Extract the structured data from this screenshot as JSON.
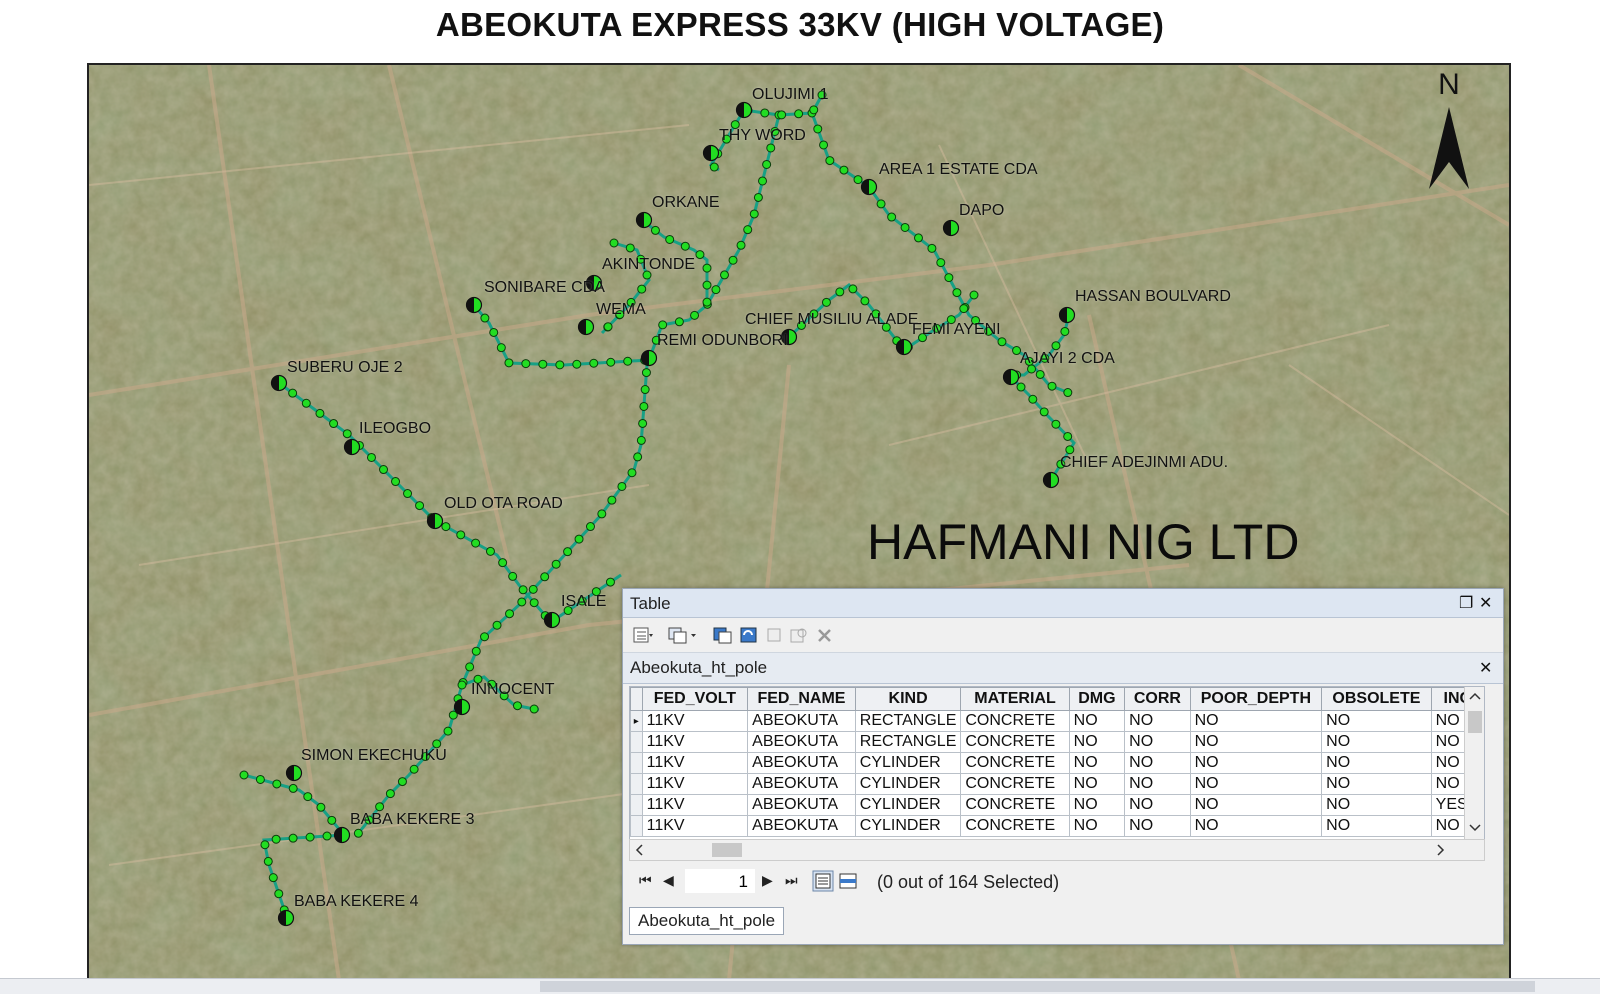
{
  "map": {
    "title": "ABEOKUTA EXPRESS 33KV (HIGH VOLTAGE)",
    "company": "HAFMANI NIG LTD",
    "north_label": "N",
    "colors": {
      "line": "#17a085",
      "node": "#22dd22",
      "node_outline": "#0b3b0b",
      "imagery": "#8c8a5c"
    },
    "labels": [
      "OLUJIMI 1",
      "THY WORD",
      "AREA 1 ESTATE CDA",
      "DAPO",
      "ORKANE",
      "AKINTONDE",
      "SONIBARE CDA",
      "WEMA",
      "REMI ODUNBORI",
      "CHIEF MUSILIU ALADE",
      "FEMI AYENI",
      "HASSAN BOULVARD",
      "AJAYI 2 CDA",
      "SUBERU OJE 2",
      "ILEOGBO",
      "CHIEF ADEJINMI ADU.",
      "OLD OTA ROAD",
      "ISALE",
      "INNOCENT",
      "SIMON EKECHUKU",
      "BABA KEKERE 3",
      "BABA KEKERE 4"
    ]
  },
  "table_window": {
    "title": "Table",
    "restore_glyph": "❐",
    "close_glyph": "✕",
    "layer_tab": "Abeokuta_ht_pole",
    "layer_close": "✕",
    "columns": [
      "FED_VOLT",
      "FED_NAME",
      "KIND",
      "MATERIAL",
      "DMG",
      "CORR",
      "POOR_DEPTH",
      "OBSOLETE",
      "INC"
    ],
    "rows": [
      [
        "11KV",
        "ABEOKUTA",
        "RECTANGLE",
        "CONCRETE",
        "NO",
        "NO",
        "NO",
        "NO",
        "NO"
      ],
      [
        "11KV",
        "ABEOKUTA",
        "RECTANGLE",
        "CONCRETE",
        "NO",
        "NO",
        "NO",
        "NO",
        "NO"
      ],
      [
        "11KV",
        "ABEOKUTA",
        "CYLINDER",
        "CONCRETE",
        "NO",
        "NO",
        "NO",
        "NO",
        "NO"
      ],
      [
        "11KV",
        "ABEOKUTA",
        "CYLINDER",
        "CONCRETE",
        "NO",
        "NO",
        "NO",
        "NO",
        "NO"
      ],
      [
        "11KV",
        "ABEOKUTA",
        "CYLINDER",
        "CONCRETE",
        "NO",
        "NO",
        "NO",
        "NO",
        "YES"
      ],
      [
        "11KV",
        "ABEOKUTA",
        "CYLINDER",
        "CONCRETE",
        "NO",
        "NO",
        "NO",
        "NO",
        "NO"
      ]
    ],
    "current_record": "1",
    "selection_status": "(0 out of 164 Selected)",
    "bottom_tab": "Abeokuta_ht_pole"
  }
}
